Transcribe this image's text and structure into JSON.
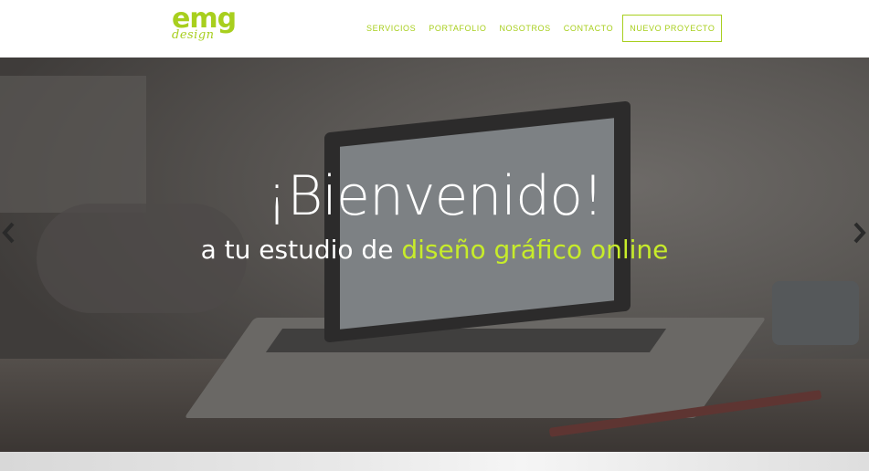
{
  "brand": {
    "logo_main": "emg",
    "logo_sub": "design"
  },
  "nav": {
    "items": [
      {
        "label": "SERVICIOS"
      },
      {
        "label": "PORTAFOLIO"
      },
      {
        "label": "NOSOTROS"
      },
      {
        "label": "CONTACTO"
      }
    ],
    "cta_label": "NUEVO PROYECTO"
  },
  "hero": {
    "title": "¡Bienvenido!",
    "subtitle_plain": "a tu estudio de ",
    "subtitle_highlight": "diseño gráfico online",
    "prev_icon": "chevron-left-icon",
    "next_icon": "chevron-right-icon"
  },
  "colors": {
    "accent": "#a8cf1e",
    "highlight": "#c7ec2a",
    "hero_overlay": "#3f3c3a"
  }
}
